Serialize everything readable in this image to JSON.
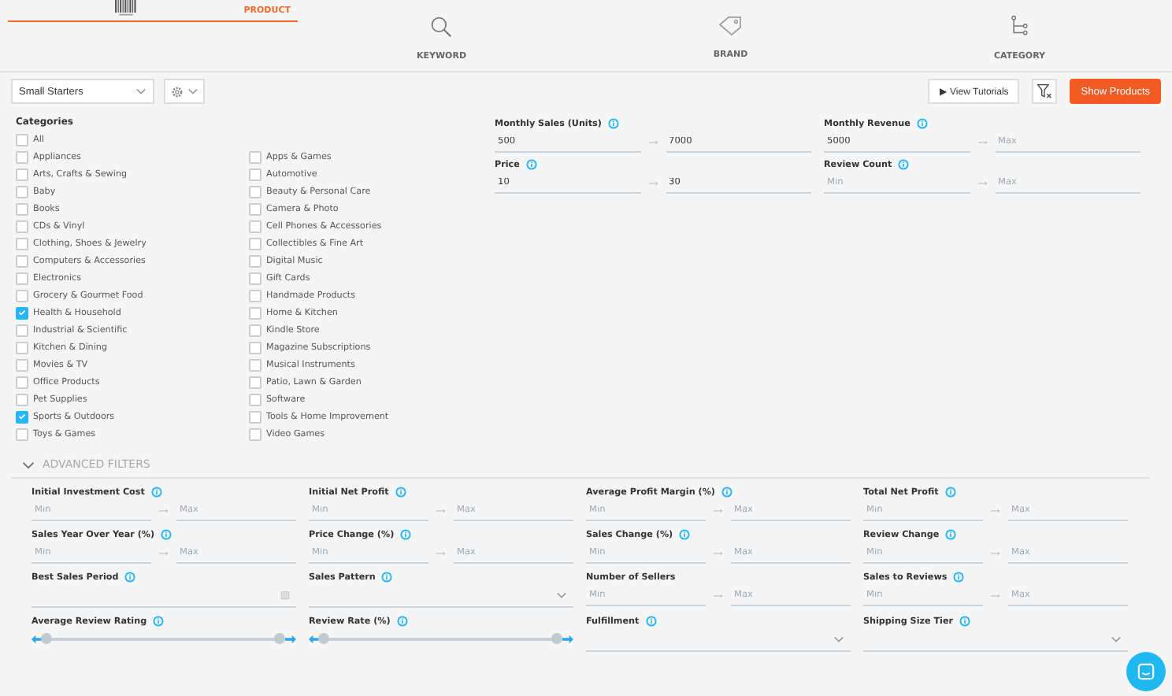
{
  "tabs": [
    {
      "label": "PRODUCT",
      "selected": true
    },
    {
      "label": "KEYWORD",
      "selected": false
    },
    {
      "label": "BRAND",
      "selected": false
    },
    {
      "label": "CATEGORY",
      "selected": false
    }
  ],
  "toolbar": {
    "preset": "Small Starters",
    "tutorials": "▶ View Tutorials",
    "show": "Show Products"
  },
  "categories": {
    "title": "Categories",
    "left": [
      {
        "label": "All",
        "checked": false
      },
      {
        "label": "Appliances",
        "checked": false
      },
      {
        "label": "Arts, Crafts & Sewing",
        "checked": false
      },
      {
        "label": "Baby",
        "checked": false
      },
      {
        "label": "Books",
        "checked": false
      },
      {
        "label": "CDs & Vinyl",
        "checked": false
      },
      {
        "label": "Clothing, Shoes & Jewelry",
        "checked": false
      },
      {
        "label": "Computers & Accessories",
        "checked": false
      },
      {
        "label": "Electronics",
        "checked": false
      },
      {
        "label": "Grocery & Gourmet Food",
        "checked": false
      },
      {
        "label": "Health & Household",
        "checked": true
      },
      {
        "label": "Industrial & Scientific",
        "checked": false
      },
      {
        "label": "Kitchen & Dining",
        "checked": false
      },
      {
        "label": "Movies & TV",
        "checked": false
      },
      {
        "label": "Office Products",
        "checked": false
      },
      {
        "label": "Pet Supplies",
        "checked": false
      },
      {
        "label": "Sports & Outdoors",
        "checked": true
      },
      {
        "label": "Toys & Games",
        "checked": false
      }
    ],
    "right": [
      {
        "label": "Apps & Games",
        "checked": false
      },
      {
        "label": "Automotive",
        "checked": false
      },
      {
        "label": "Beauty & Personal Care",
        "checked": false
      },
      {
        "label": "Camera & Photo",
        "checked": false
      },
      {
        "label": "Cell Phones & Accessories",
        "checked": false
      },
      {
        "label": "Collectibles & Fine Art",
        "checked": false
      },
      {
        "label": "Digital Music",
        "checked": false
      },
      {
        "label": "Gift Cards",
        "checked": false
      },
      {
        "label": "Handmade Products",
        "checked": false
      },
      {
        "label": "Home & Kitchen",
        "checked": false
      },
      {
        "label": "Kindle Store",
        "checked": false
      },
      {
        "label": "Magazine Subscriptions",
        "checked": false
      },
      {
        "label": "Musical Instruments",
        "checked": false
      },
      {
        "label": "Patio, Lawn & Garden",
        "checked": false
      },
      {
        "label": "Software",
        "checked": false
      },
      {
        "label": "Tools & Home Improvement",
        "checked": false
      },
      {
        "label": "Video Games",
        "checked": false
      }
    ]
  },
  "main_filters": [
    {
      "label": "Monthly Sales (Units)",
      "min": {
        "value": "500"
      },
      "max": {
        "value": "7000"
      }
    },
    {
      "label": "Monthly Revenue",
      "min": {
        "value": "5000"
      },
      "max": {
        "placeholder": "Max"
      }
    },
    {
      "label": "Price",
      "min": {
        "value": "10"
      },
      "max": {
        "value": "30"
      }
    },
    {
      "label": "Review Count",
      "min": {
        "placeholder": "Min"
      },
      "max": {
        "placeholder": "Max"
      }
    }
  ],
  "advanced": {
    "title": "ADVANCED FILTERS",
    "expanded": true,
    "filters": [
      {
        "kind": "range",
        "label": "Initial Investment Cost",
        "info": true,
        "min": {
          "placeholder": "Min"
        },
        "max": {
          "placeholder": "Max"
        }
      },
      {
        "kind": "range",
        "label": "Initial Net Profit",
        "info": true,
        "min": {
          "placeholder": "Min"
        },
        "max": {
          "placeholder": "Max"
        }
      },
      {
        "kind": "range",
        "label": "Average Profit Margin (%)",
        "info": true,
        "min": {
          "placeholder": "Min"
        },
        "max": {
          "placeholder": "Max"
        }
      },
      {
        "kind": "range",
        "label": "Total Net Profit",
        "info": true,
        "min": {
          "placeholder": "Min"
        },
        "max": {
          "placeholder": "Max"
        }
      },
      {
        "kind": "range",
        "label": "Sales Year Over Year (%)",
        "info": true,
        "min": {
          "placeholder": "Min"
        },
        "max": {
          "placeholder": "Max"
        }
      },
      {
        "kind": "range",
        "label": "Price Change (%)",
        "info": true,
        "min": {
          "placeholder": "Min"
        },
        "max": {
          "placeholder": "Max"
        }
      },
      {
        "kind": "range",
        "label": "Sales Change (%)",
        "info": true,
        "min": {
          "placeholder": "Min"
        },
        "max": {
          "placeholder": "Max"
        }
      },
      {
        "kind": "range",
        "label": "Review Change",
        "info": true,
        "min": {
          "placeholder": "Min"
        },
        "max": {
          "placeholder": "Max"
        }
      },
      {
        "kind": "date",
        "label": "Best Sales Period",
        "info": true
      },
      {
        "kind": "select",
        "label": "Sales Pattern",
        "info": true
      },
      {
        "kind": "range",
        "label": "Number of Sellers",
        "info": false,
        "min": {
          "placeholder": "Min"
        },
        "max": {
          "placeholder": "Max"
        }
      },
      {
        "kind": "range",
        "label": "Sales to Reviews",
        "info": true,
        "min": {
          "placeholder": "Min"
        },
        "max": {
          "placeholder": "Max"
        }
      },
      {
        "kind": "slider",
        "label": "Average Review Rating",
        "info": true,
        "thumbs": [
          {
            "level": 0
          },
          {
            "level": 1
          }
        ]
      },
      {
        "kind": "slider",
        "label": "Review Rate (%)",
        "info": true,
        "thumbs": [
          {
            "level": 0
          },
          {
            "level": 1
          }
        ]
      },
      {
        "kind": "select",
        "label": "Fulfillment",
        "info": true
      },
      {
        "kind": "select",
        "label": "Shipping Size Tier",
        "info": true
      }
    ]
  }
}
